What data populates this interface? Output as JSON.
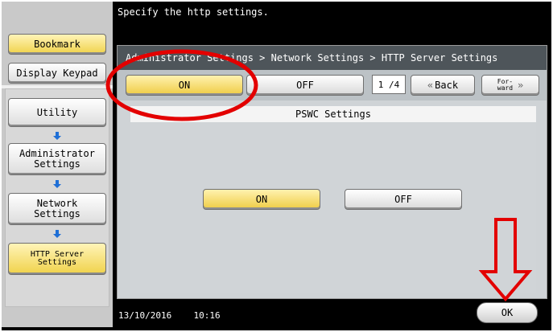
{
  "top_message": "Specify the http settings.",
  "sidebar": {
    "bookmark_label": "Bookmark",
    "display_keypad_label": "Display Keypad",
    "utility_label": "Utility",
    "admin_label_1": "Administrator",
    "admin_label_2": "Settings",
    "network_label_1": "Network",
    "network_label_2": "Settings",
    "http_label_1": "HTTP Server",
    "http_label_2": "Settings"
  },
  "header": {
    "breadcrumb": "Administrator Settings > Network Settings > HTTP Server Settings"
  },
  "toggle": {
    "on_label": "ON",
    "off_label": "OFF",
    "selected": "ON"
  },
  "pager": {
    "page": "1 /4",
    "back_label": "Back",
    "forward_label_1": "For-",
    "forward_label_2": "ward"
  },
  "section": {
    "title": "PSWC Settings",
    "on_label": "ON",
    "off_label": "OFF",
    "selected": "ON"
  },
  "footer": {
    "date": "13/10/2016",
    "time": "10:16",
    "ok_label": "OK"
  },
  "colors": {
    "selected": "#f0d24a",
    "annotation": "#e30000",
    "header_bg": "#4e555a"
  }
}
